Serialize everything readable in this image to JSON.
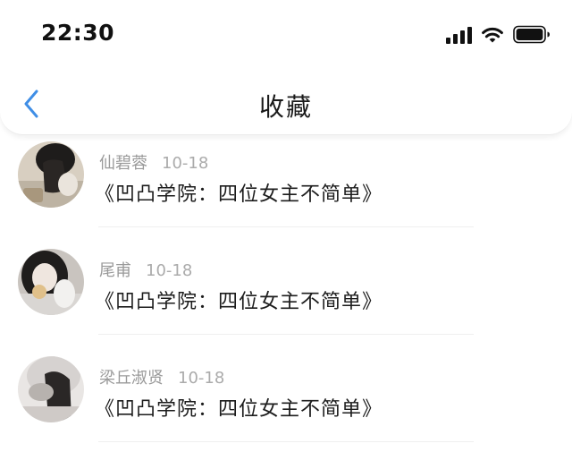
{
  "status_bar": {
    "time": "22:30",
    "icons": [
      "signal-icon",
      "wifi-icon",
      "battery-icon"
    ]
  },
  "nav": {
    "back_icon": "chevron-left-icon",
    "title": "收藏"
  },
  "colors": {
    "accent": "#3f8ee6",
    "meta_text": "#9a9a9a",
    "title_text": "#1c1c1c"
  },
  "favorites": [
    {
      "author": "仙碧蓉",
      "date": "10-18",
      "title": "《凹凸学院：四位女主不简单》"
    },
    {
      "author": "尾甫",
      "date": "10-18",
      "title": "《凹凸学院：四位女主不简单》"
    },
    {
      "author": "梁丘淑贤",
      "date": "10-18",
      "title": "《凹凸学院：四位女主不简单》"
    }
  ]
}
